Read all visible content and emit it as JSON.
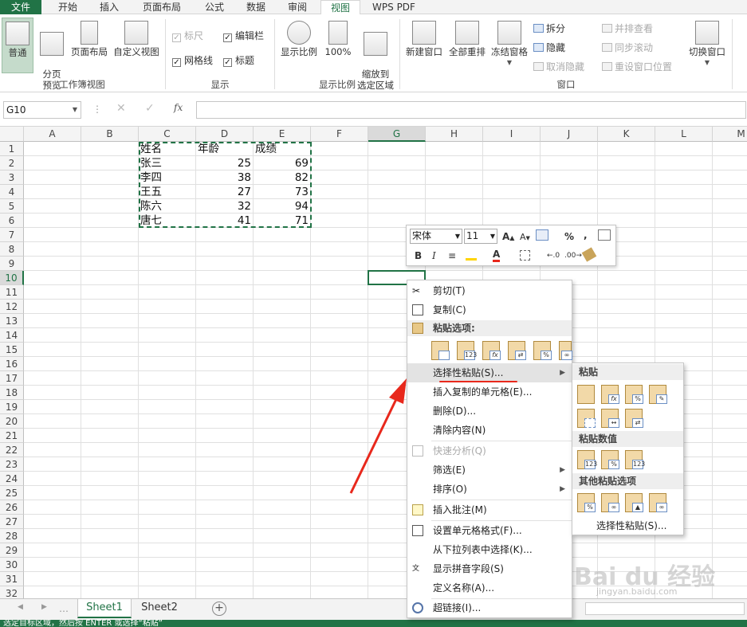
{
  "ribbon_tabs": [
    "文件",
    "开始",
    "插入",
    "页面布局",
    "公式",
    "数据",
    "审阅",
    "视图",
    "WPS PDF"
  ],
  "active_tab": "视图",
  "ribbon": {
    "workbook_views": {
      "buttons": [
        "普通",
        "分页\n预览",
        "页面布局",
        "自定义视图"
      ],
      "group": "工作簿视图"
    },
    "show": {
      "items": [
        {
          "label": "标尺",
          "checked": true,
          "disabled": true
        },
        {
          "label": "编辑栏",
          "checked": true,
          "disabled": false
        },
        {
          "label": "网格线",
          "checked": true,
          "disabled": false
        },
        {
          "label": "标题",
          "checked": true,
          "disabled": false
        }
      ],
      "group": "显示"
    },
    "zoom": {
      "buttons": [
        "显示比例",
        "100%",
        "缩放到\n选定区域"
      ],
      "group": "显示比例"
    },
    "window": {
      "buttons": [
        "新建窗口",
        "全部重排",
        "冻结窗格"
      ],
      "small_left": [
        {
          "label": "拆分",
          "disabled": false
        },
        {
          "label": "隐藏",
          "disabled": false
        },
        {
          "label": "取消隐藏",
          "disabled": true
        }
      ],
      "small_right": [
        {
          "label": "并排查看",
          "disabled": true
        },
        {
          "label": "同步滚动",
          "disabled": true
        },
        {
          "label": "重设窗口位置",
          "disabled": true
        }
      ],
      "switch": "切换窗口",
      "group": "窗口"
    }
  },
  "formula_bar": {
    "name_box": "G10",
    "fx": "fx",
    "content": ""
  },
  "columns": [
    "A",
    "B",
    "C",
    "D",
    "E",
    "F",
    "G",
    "H",
    "I",
    "J",
    "K",
    "L",
    "M"
  ],
  "selected_column": "G",
  "selected_row": 10,
  "rows": [
    "1",
    "2",
    "3",
    "4",
    "5",
    "6",
    "7",
    "8",
    "9",
    "10",
    "11",
    "12",
    "13",
    "14",
    "15",
    "16",
    "17",
    "18",
    "19",
    "20",
    "21",
    "22",
    "23",
    "24",
    "25",
    "26",
    "27",
    "28",
    "29",
    "30",
    "31",
    "32"
  ],
  "table": {
    "headers": [
      "姓名",
      "年龄",
      "成绩"
    ],
    "rows": [
      [
        "张三",
        "25",
        "69"
      ],
      [
        "李四",
        "38",
        "82"
      ],
      [
        "王五",
        "27",
        "73"
      ],
      [
        "陈六",
        "32",
        "94"
      ],
      [
        "唐七",
        "41",
        "71"
      ]
    ]
  },
  "mini_toolbar": {
    "font": "宋体",
    "size": "11",
    "percent": "%",
    "comma": ",",
    "bold": "B",
    "italic": "I"
  },
  "context_menu": {
    "cut": "剪切(T)",
    "copy": "复制(C)",
    "paste_options": "粘贴选项:",
    "paste_special": "选择性粘贴(S)...",
    "insert_copied": "插入复制的单元格(E)...",
    "delete": "删除(D)...",
    "clear": "清除内容(N)",
    "quick_analysis": "快速分析(Q)",
    "filter": "筛选(E)",
    "sort": "排序(O)",
    "insert_comment": "插入批注(M)",
    "format_cells": "设置单元格格式(F)...",
    "pick_list": "从下拉列表中选择(K)...",
    "phonetic": "显示拼音字段(S)",
    "define_name": "定义名称(A)...",
    "hyperlink": "超链接(I)..."
  },
  "submenu": {
    "paste": "粘贴",
    "paste_values": "粘贴数值",
    "other": "其他粘贴选项",
    "special": "选择性粘贴(S)..."
  },
  "sheets": [
    "Sheet1",
    "Sheet2"
  ],
  "active_sheet": "Sheet1",
  "status_text": "选定目标区域，然后按 ENTER 或选择“粘贴”",
  "watermark": "Bai du 经验",
  "watermark_url": "jingyan.baidu.com",
  "colors": {
    "accent": "#217346",
    "annotation": "#e8281c",
    "marching_ants": "#217346"
  }
}
